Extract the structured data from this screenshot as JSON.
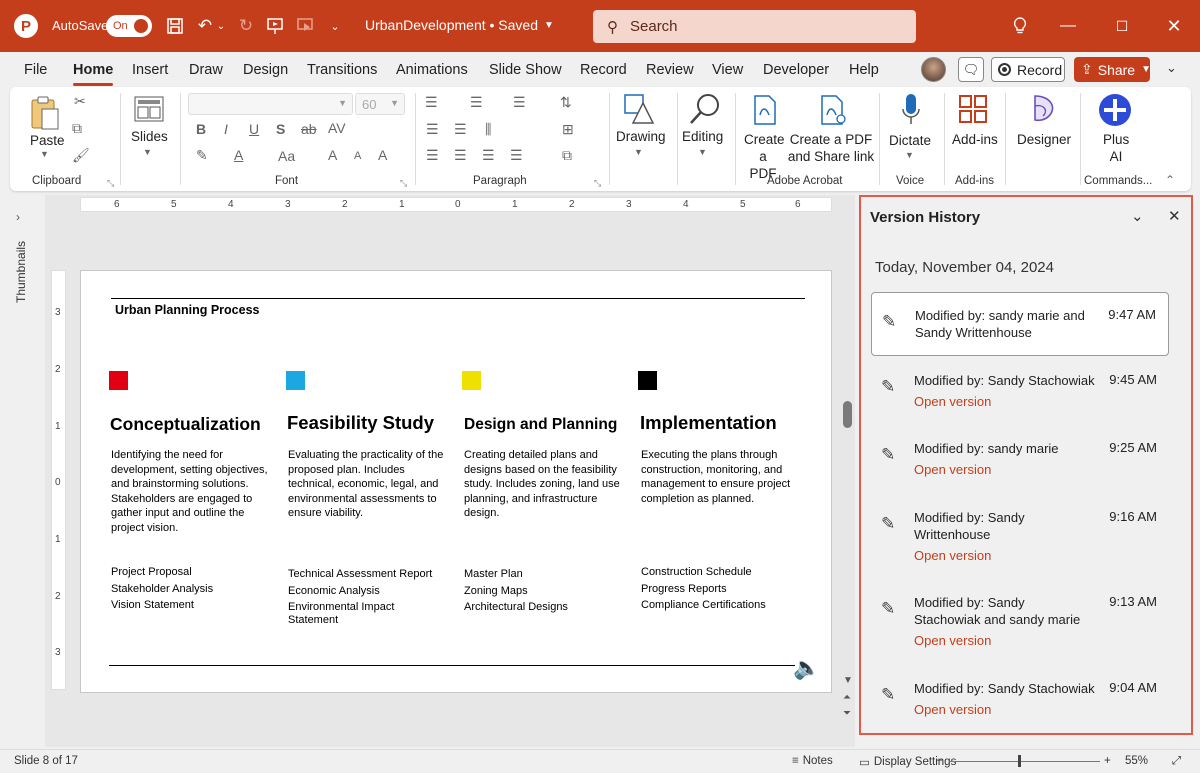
{
  "titlebar": {
    "autosave_label": "AutoSave",
    "autosave_state": "On",
    "doc_title": "UrbanDevelopment • Saved",
    "search_placeholder": "Search"
  },
  "menu": {
    "tabs": [
      "File",
      "Home",
      "Insert",
      "Draw",
      "Design",
      "Transitions",
      "Animations",
      "Slide Show",
      "Record",
      "Review",
      "View",
      "Developer",
      "Help"
    ],
    "active_tab": "Home",
    "record_label": "Record",
    "share_label": "Share"
  },
  "ribbon": {
    "paste": "Paste",
    "clipboard": "Clipboard",
    "slides": "Slides",
    "font_size": "60",
    "font": "Font",
    "paragraph": "Paragraph",
    "drawing": "Drawing",
    "editing": "Editing",
    "create_pdf_1": "Create",
    "create_pdf_2": "a PDF",
    "create_share_1": "Create a PDF",
    "create_share_2": "and Share link",
    "adobe_acrobat": "Adobe Acrobat",
    "dictate": "Dictate",
    "voice": "Voice",
    "addins_btn": "Add-ins",
    "addins_group": "Add-ins",
    "designer": "Designer",
    "plus_ai_1": "Plus",
    "plus_ai_2": "AI",
    "commands": "Commands..."
  },
  "thumbnails_label": "Thumbnails",
  "hruler_labels": [
    "6",
    "5",
    "4",
    "3",
    "2",
    "1",
    "0",
    "1",
    "2",
    "3",
    "4",
    "5",
    "6"
  ],
  "vruler_labels": [
    "3",
    "2",
    "1",
    "0",
    "1",
    "2",
    "3"
  ],
  "slide": {
    "title": "Urban Planning Process",
    "columns": [
      {
        "color": "#e00012",
        "heading": "Conceptualization",
        "body": "Identifying the need for development, setting objectives, and brainstorming solutions. Stakeholders are engaged to gather input and outline the project vision.",
        "items": [
          "Project Proposal",
          "Stakeholder Analysis",
          "Vision Statement"
        ]
      },
      {
        "color": "#1ba8e0",
        "heading": "Feasibility Study",
        "body": "Evaluating the practicality of the proposed plan. Includes technical, economic, legal, and environmental assessments to ensure viability.",
        "items": [
          "Technical Assessment Report",
          "Economic Analysis",
          "Environmental Impact Statement"
        ]
      },
      {
        "color": "#f0e000",
        "heading": "Design and Planning",
        "body": "Creating detailed plans and designs based on the feasibility study. Includes zoning, land use planning, and infrastructure design.",
        "items": [
          "Master Plan",
          "Zoning Maps",
          "Architectural Designs"
        ]
      },
      {
        "color": "#000000",
        "heading": "Implementation",
        "body": "Executing the plans through construction, monitoring, and management to ensure project completion as planned.",
        "items": [
          "Construction Schedule",
          "Progress Reports",
          "Compliance Certifications"
        ]
      }
    ]
  },
  "version_history": {
    "title": "Version History",
    "date": "Today, November 04, 2024",
    "entries": [
      {
        "who": "Modified by: sandy marie and Sandy Writtenhouse",
        "time": "9:47 AM",
        "open": ""
      },
      {
        "who": "Modified by: Sandy Stachowiak",
        "time": "9:45 AM",
        "open": "Open version"
      },
      {
        "who": "Modified by: sandy marie",
        "time": "9:25 AM",
        "open": "Open version"
      },
      {
        "who": "Modified by: Sandy Writtenhouse",
        "time": "9:16 AM",
        "open": "Open version"
      },
      {
        "who": "Modified by: Sandy Stachowiak and sandy marie",
        "time": "9:13 AM",
        "open": "Open version"
      },
      {
        "who": "Modified by: Sandy Stachowiak",
        "time": "9:04 AM",
        "open": "Open version"
      }
    ]
  },
  "statusbar": {
    "slide_count": "Slide 8 of 17",
    "notes": "Notes",
    "display_settings": "Display Settings",
    "zoom": "55%"
  },
  "colors": {
    "brand": "#c43e1c",
    "pane_border": "#e25a4a"
  }
}
